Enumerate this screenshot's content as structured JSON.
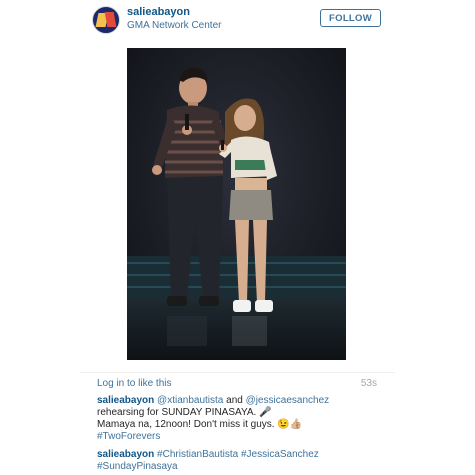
{
  "post": {
    "username": "salieabayon",
    "location": "GMA Network Center",
    "follow_label": "FOLLOW"
  },
  "meta": {
    "login_link": "Log in",
    "login_suffix": " to like this",
    "timestamp": "53s"
  },
  "comments": [
    {
      "user": "salieabayon",
      "mention1": "@xtianbautista",
      "and": " and ",
      "mention2": "@jessicaesanchez",
      "line2": "rehearsing for SUNDAY PINASAYA. 🎤",
      "line3": "Mamaya na, 12noon! Don't miss it guys. 😉👍🏼",
      "hashtag": "#TwoForevers"
    },
    {
      "user": "salieabayon",
      "tags_line1": "#ChristianBautista #JessicaSanchez",
      "tags_line2": "#SundayPinasaya"
    }
  ]
}
